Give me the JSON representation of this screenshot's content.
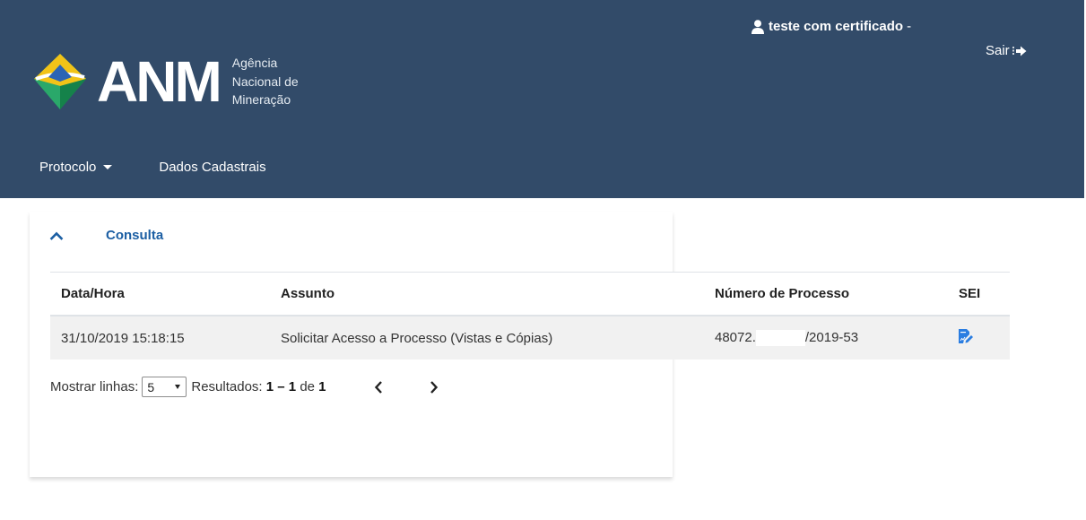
{
  "header": {
    "logo": {
      "word": "ANM",
      "subtitle_lines": [
        "Agência",
        "Nacional de",
        "Mineração"
      ]
    },
    "user": {
      "name": "teste com certificado",
      "suffix": "-"
    },
    "logout_label": "Sair",
    "nav": [
      {
        "label": "Protocolo",
        "has_dropdown": true
      },
      {
        "label": "Dados Cadastrais",
        "has_dropdown": false
      }
    ],
    "colors": {
      "background": "#324b69",
      "accent": "#1b5ea3"
    }
  },
  "section": {
    "title": "Consulta",
    "expanded": true
  },
  "table": {
    "columns": [
      "Data/Hora",
      "Assunto",
      "Número de Processo",
      "SEI"
    ],
    "rows": [
      {
        "datetime": "31/10/2019 15:18:15",
        "subject": "Solicitar Acesso a Processo (Vistas e Cópias)",
        "process_prefix": "48072.",
        "process_suffix": "/2019-53",
        "sei_icon": "edit-document-icon"
      }
    ]
  },
  "pagination": {
    "rows_label": "Mostrar linhas:",
    "rows_value": "5",
    "results_label": "Resultados:",
    "results_range": "1 – 1",
    "results_of": "de",
    "results_total": "1",
    "prev_icon": "chevron-left-icon",
    "next_icon": "chevron-right-icon"
  }
}
